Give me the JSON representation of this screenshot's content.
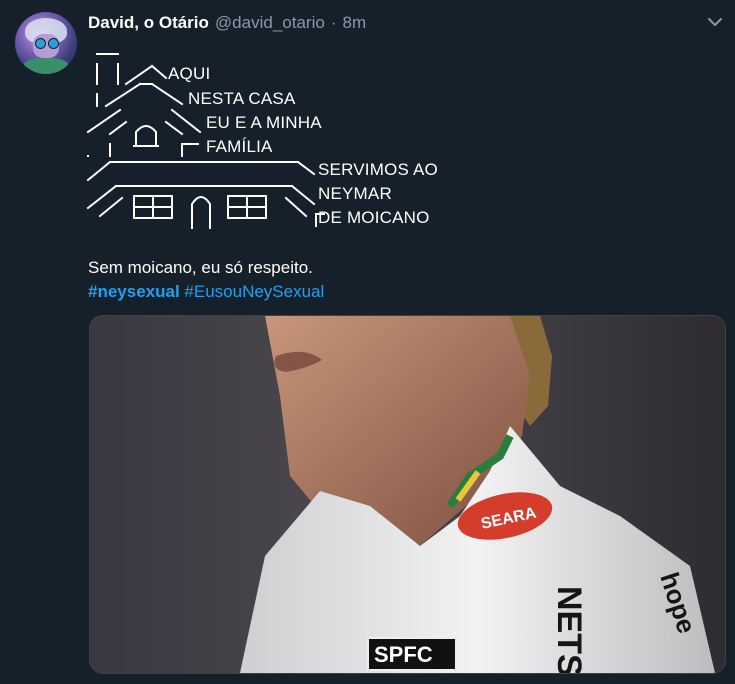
{
  "tweet": {
    "display_name": "David, o Otário",
    "handle": "@david_otario",
    "separator": "·",
    "time": "8m",
    "caption": "Sem moicano, eu só respeito.",
    "hashtags": [
      "#neysexual",
      "#EusouNeySexual"
    ]
  },
  "ascii_art": {
    "lines": [
      "AQUI",
      "NESTA CASA",
      "EU E A MINHA",
      "FAMÍLIA",
      "SERVIMOS AO",
      "NEYMAR",
      "DE MOICANO"
    ]
  },
  "media": {
    "shirt_logo": "SPFC",
    "sponsor": "SEARA",
    "sleeve_text": "NETS",
    "collar_text": "hope"
  },
  "colors": {
    "background": "#15202b",
    "text": "#ffffff",
    "secondary": "#8899a6",
    "link": "#1da1f2"
  }
}
